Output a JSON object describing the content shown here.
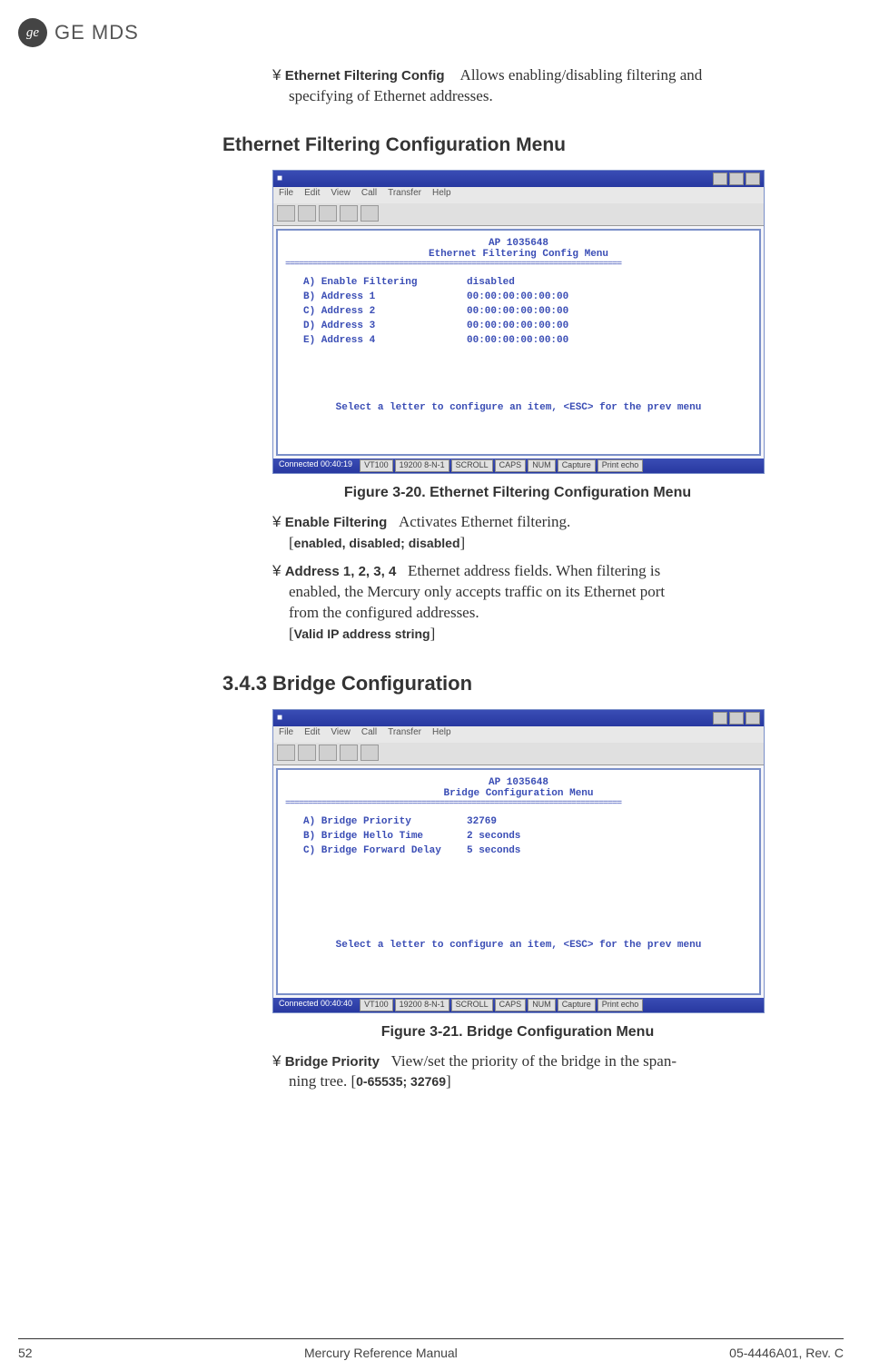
{
  "header": {
    "brand": "GE MDS"
  },
  "intro_item": {
    "bullet": "¥",
    "label": "Ethernet Filtering Config",
    "desc_part1": "Allows enabling/disabling filtering and",
    "desc_part2": "specifying of Ethernet addresses."
  },
  "section_heading": "Ethernet Filtering Configuration Menu",
  "terminal1": {
    "titlebar": "■ ",
    "menubar": [
      "File",
      "Edit",
      "View",
      "Call",
      "Transfer",
      "Help"
    ],
    "header": "AP 1035648",
    "title": "Ethernet Filtering Config Menu",
    "rows": [
      {
        "key": "A) Enable Filtering",
        "val": "disabled"
      },
      {
        "key": "B) Address 1",
        "val": "00:00:00:00:00:00"
      },
      {
        "key": "C) Address 2",
        "val": "00:00:00:00:00:00"
      },
      {
        "key": "D) Address 3",
        "val": "00:00:00:00:00:00"
      },
      {
        "key": "E) Address 4",
        "val": "00:00:00:00:00:00"
      }
    ],
    "footer": "Select a letter to configure an item, <ESC> for the prev menu",
    "statusbar": {
      "conn": "Connected 00:40:19",
      "items": [
        "VT100",
        "19200 8-N-1",
        "SCROLL",
        "CAPS",
        "NUM",
        "Capture",
        "Print echo"
      ]
    }
  },
  "figure1_caption": "Figure 3-20. Ethernet Filtering Configuration Menu",
  "items_after_fig1": [
    {
      "bullet": "¥",
      "label": "Enable Filtering",
      "desc": "Activates Ethernet filtering.",
      "range_open": "[",
      "range": "enabled, disabled; disabled",
      "range_close": "]"
    },
    {
      "bullet": "¥",
      "label": "Address 1, 2, 3, 4",
      "desc_lines": [
        "Ethernet address fields. When filtering is",
        "enabled, the Mercury only accepts traffic on its Ethernet port",
        "from the configured addresses."
      ],
      "range_open": "[",
      "range": "Valid IP address string",
      "range_close": "]"
    }
  ],
  "subsection_heading": "3.4.3 Bridge Configuration",
  "terminal2": {
    "titlebar": "■ ",
    "menubar": [
      "File",
      "Edit",
      "View",
      "Call",
      "Transfer",
      "Help"
    ],
    "header": "AP 1035648",
    "title": "Bridge Configuration Menu",
    "rows": [
      {
        "key": "A) Bridge Priority",
        "val": "32769"
      },
      {
        "key": "B) Bridge Hello Time",
        "val": "2 seconds"
      },
      {
        "key": "C) Bridge Forward Delay",
        "val": "5 seconds"
      }
    ],
    "footer": "Select a letter to configure an item, <ESC> for the prev menu",
    "statusbar": {
      "conn": "Connected 00:40:40",
      "items": [
        "VT100",
        "19200 8-N-1",
        "SCROLL",
        "CAPS",
        "NUM",
        "Capture",
        "Print echo"
      ]
    }
  },
  "figure2_caption": "Figure 3-21. Bridge Configuration Menu",
  "item_after_fig2": {
    "bullet": "¥",
    "label": "Bridge Priority",
    "desc_lines": [
      "View/set the priority of the bridge in the span-",
      "ning tree. "
    ],
    "range_open": "[",
    "range": "0-65535; 32769",
    "range_close": "]"
  },
  "footer": {
    "page": "52",
    "center": "Mercury Reference Manual",
    "right": "05-4446A01, Rev. C"
  }
}
